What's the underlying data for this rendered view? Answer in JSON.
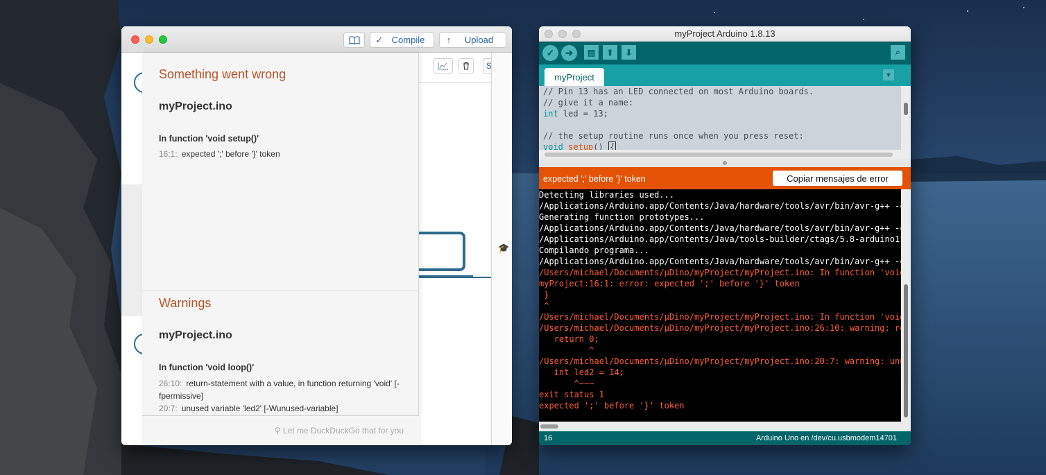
{
  "colors": {
    "accent_teal": "#006468",
    "error_orange": "#e35205",
    "error_text": "#ff5d3a",
    "section_title": "#b8542a"
  },
  "left_window": {
    "toolbar": {
      "docs_icon": "book-icon",
      "compile_glyph": "✓",
      "compile_label": "Compile",
      "upload_glyph": "↑",
      "upload_label": "Upload"
    },
    "errors": {
      "title": "Something went wrong",
      "file": "myProject.ino",
      "function": "In function 'void setup()'",
      "items": [
        {
          "location": "16:1:",
          "message": "expected ';' before '}' token"
        }
      ]
    },
    "warnings": {
      "title": "Warnings",
      "file": "myProject.ino",
      "function": "In function 'void loop()'",
      "items": [
        {
          "location": "26:10:",
          "message": "return-statement with a value, in function returning 'void' [-fpermissive]"
        },
        {
          "location": "20:7:",
          "message": "unused variable 'led2' [-Wunused-variable]"
        }
      ]
    },
    "footer_search": "Let me DuckDuckGo that for you",
    "side_buttons": {
      "chart_icon": "chart-icon",
      "trash_icon": "trash-icon",
      "partial_label": "S"
    }
  },
  "right_window": {
    "title": "myProject Arduino 1.8.13",
    "tab": "myProject",
    "error_bar_message": "expected ';' before '}' token",
    "copy_button": "Copiar mensajes de error",
    "status_line": "16",
    "status_board": "Arduino Uno en /dev/cu.usbmodem14701"
  }
}
